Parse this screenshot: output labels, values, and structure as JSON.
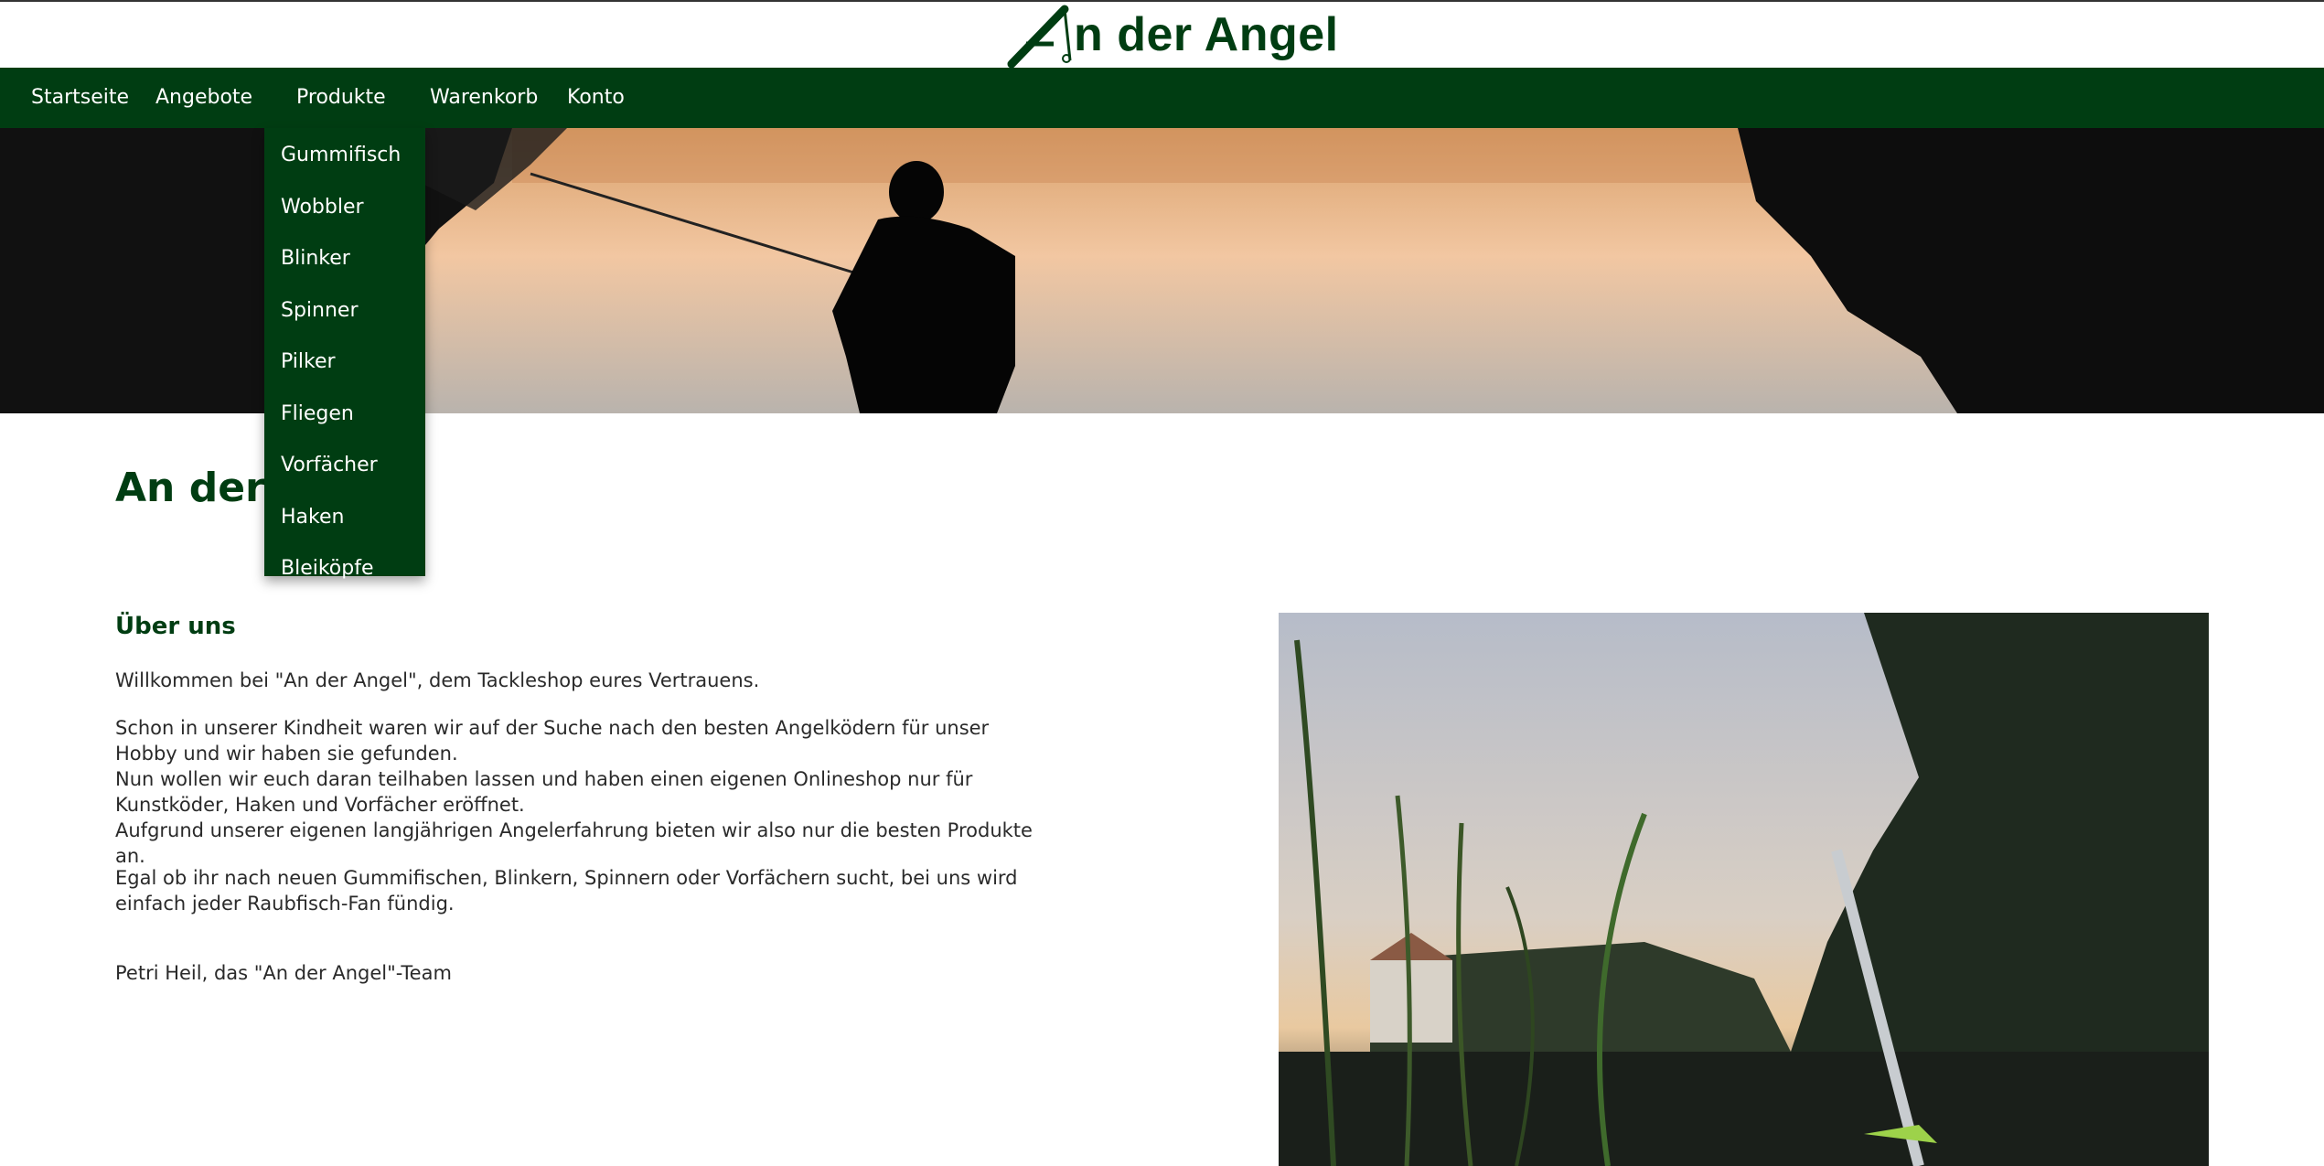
{
  "header": {
    "logo_text": "n der Angel",
    "logo_icon": "fishing-rod-a-icon",
    "brand_color": "#003d12"
  },
  "nav": {
    "items": [
      {
        "label": "Startseite"
      },
      {
        "label": "Angebote"
      },
      {
        "label": "Produkte"
      },
      {
        "label": "Warenkorb"
      },
      {
        "label": "Konto"
      }
    ],
    "dropdown": {
      "open_for": "Produkte",
      "items": [
        {
          "label": "Gummifisch"
        },
        {
          "label": "Wobbler"
        },
        {
          "label": "Blinker"
        },
        {
          "label": "Spinner"
        },
        {
          "label": "Pilker"
        },
        {
          "label": "Fliegen"
        },
        {
          "label": "Vorfächer"
        },
        {
          "label": "Haken"
        },
        {
          "label": "Bleiköpfe"
        }
      ]
    }
  },
  "main": {
    "title": "An der Angel",
    "about": {
      "heading": "Über uns",
      "p1": "Willkommen bei \"An der Angel\", dem Tackleshop eures Vertrauens.",
      "p2_lines": [
        "Schon in unserer Kindheit waren wir auf der Suche nach den besten Angelködern für unser Hobby und wir haben sie gefunden.",
        "Nun wollen wir euch daran teilhaben lassen und haben einen eigenen Onlineshop nur für Kunstköder, Haken und Vorfächer eröffnet.",
        "Aufgrund unserer eigenen langjährigen Angelerfahrung bieten wir also nur die besten Produkte an."
      ],
      "p3": "Egal ob ihr nach neuen Gummifischen, Blinkern, Spinnern oder Vorfächern sucht, bei uns wird einfach jeder Raubfisch-Fan fündig.",
      "signature": "Petri Heil, das \"An der Angel\"-Team"
    }
  }
}
